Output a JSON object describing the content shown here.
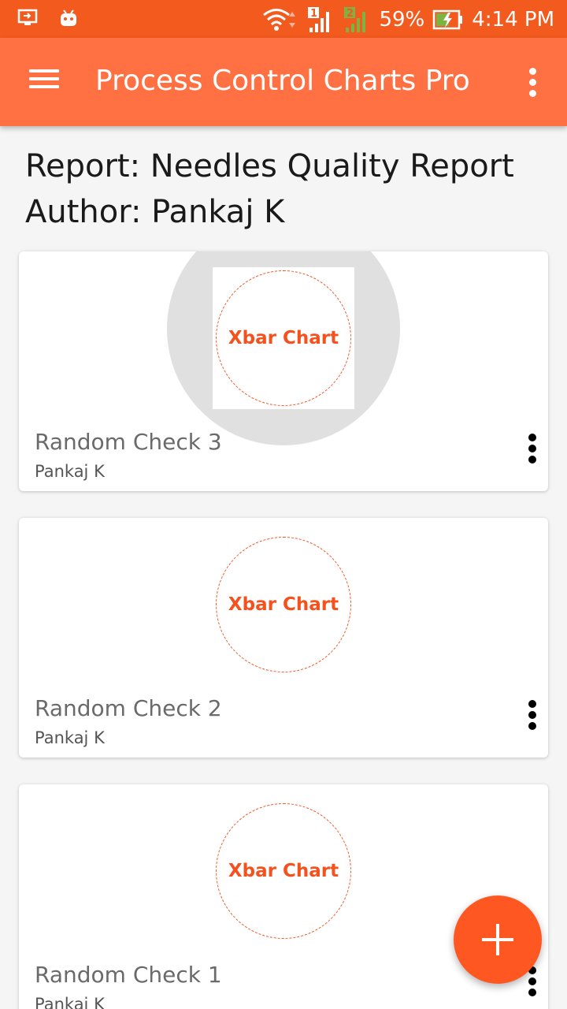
{
  "status_bar": {
    "wifi_icon": "wifi-icon",
    "sim1_label": "1",
    "sim2_label": "2",
    "battery": "59%",
    "time": "4:14 PM"
  },
  "app_bar": {
    "title": "Process Control Charts Pro",
    "menu_icon": "menu-icon",
    "overflow_icon": "more-vert-icon"
  },
  "report": {
    "report_line": "Report: Needles Quality Report",
    "author_line": "Author: Pankaj K"
  },
  "cards": [
    {
      "thumb_label": "Xbar Chart",
      "title": "Random Check 3",
      "author": "Pankaj K"
    },
    {
      "thumb_label": "Xbar Chart",
      "title": "Random Check 2",
      "author": "Pankaj K"
    },
    {
      "thumb_label": "Xbar Chart",
      "title": "Random Check 1",
      "author": "Pankaj K"
    }
  ],
  "fab": {
    "icon": "add-icon"
  },
  "colors": {
    "status_bar": "#f25a1e",
    "app_bar": "#ff7043",
    "accent": "#ff5722",
    "thumb_text": "#f4511e"
  }
}
